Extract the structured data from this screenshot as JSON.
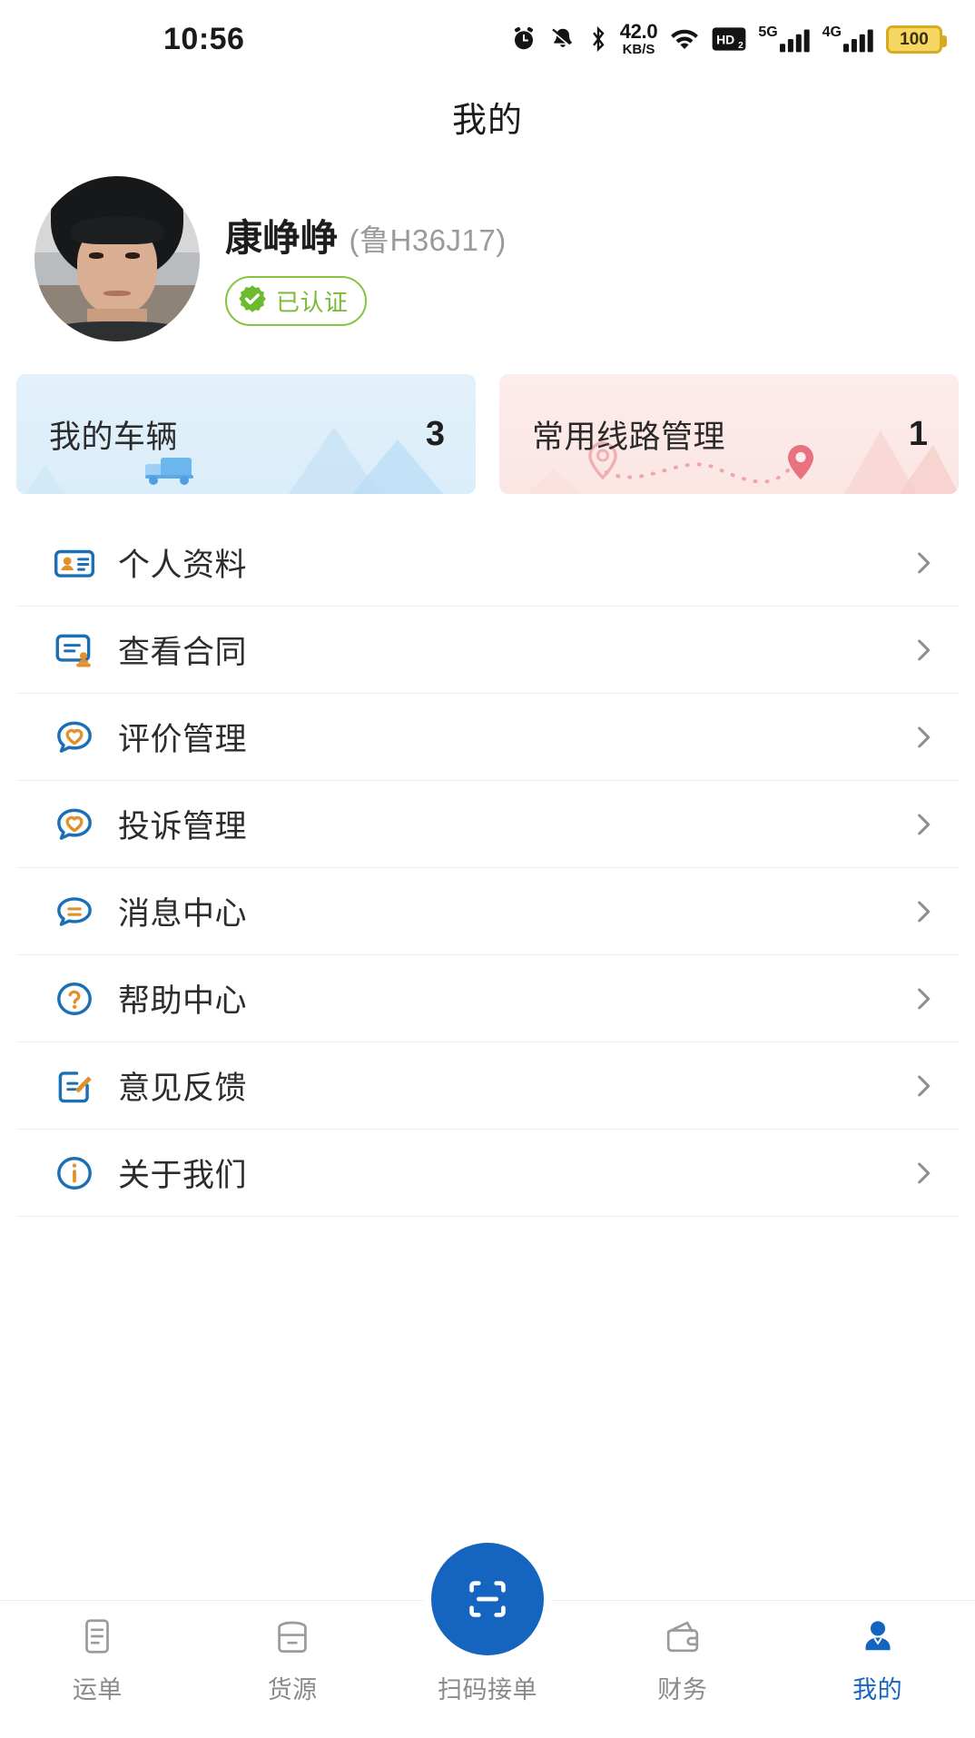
{
  "status_bar": {
    "time": "10:56",
    "net_speed_value": "42.0",
    "net_speed_unit": "KB/S",
    "hd_label": "HD",
    "signal_1_label": "5G",
    "signal_2_label": "4G",
    "battery_level": "100",
    "icons": [
      "alarm-icon",
      "mute-bell-icon",
      "bluetooth-icon",
      "wifi-icon",
      "hd-icon",
      "signal-5g-icon",
      "signal-4g-icon",
      "battery-icon"
    ]
  },
  "header": {
    "title": "我的"
  },
  "profile": {
    "name": "康峥峥",
    "plate": "(鲁H36J17)",
    "verified_label": "已认证",
    "verified_color": "#79bb36"
  },
  "cards": [
    {
      "label": "我的车辆",
      "count": "3",
      "theme": "blue",
      "accent": "#daedfa"
    },
    {
      "label": "常用线路管理",
      "count": "1",
      "theme": "pink",
      "accent": "#fbe6e4"
    }
  ],
  "menu": {
    "items": [
      {
        "label": "个人资料",
        "icon": "id-card-icon"
      },
      {
        "label": "查看合同",
        "icon": "contract-stamp-icon"
      },
      {
        "label": "评价管理",
        "icon": "review-heart-bubble-icon"
      },
      {
        "label": "投诉管理",
        "icon": "complaint-heart-bubble-icon"
      },
      {
        "label": "消息中心",
        "icon": "message-bubble-icon"
      },
      {
        "label": "帮助中心",
        "icon": "question-circle-icon"
      },
      {
        "label": "意见反馈",
        "icon": "feedback-edit-icon"
      },
      {
        "label": "关于我们",
        "icon": "info-circle-icon"
      }
    ],
    "chevron_icon": "chevron-right-icon"
  },
  "tabbar": {
    "accent": "#1565c0",
    "items": [
      {
        "label": "运单",
        "icon": "waybill-icon",
        "active": false
      },
      {
        "label": "货源",
        "icon": "cargo-icon",
        "active": false
      },
      {
        "label": "扫码接单",
        "icon": "scan-icon",
        "active": false
      },
      {
        "label": "财务",
        "icon": "wallet-icon",
        "active": false
      },
      {
        "label": "我的",
        "icon": "user-icon",
        "active": true
      }
    ]
  }
}
